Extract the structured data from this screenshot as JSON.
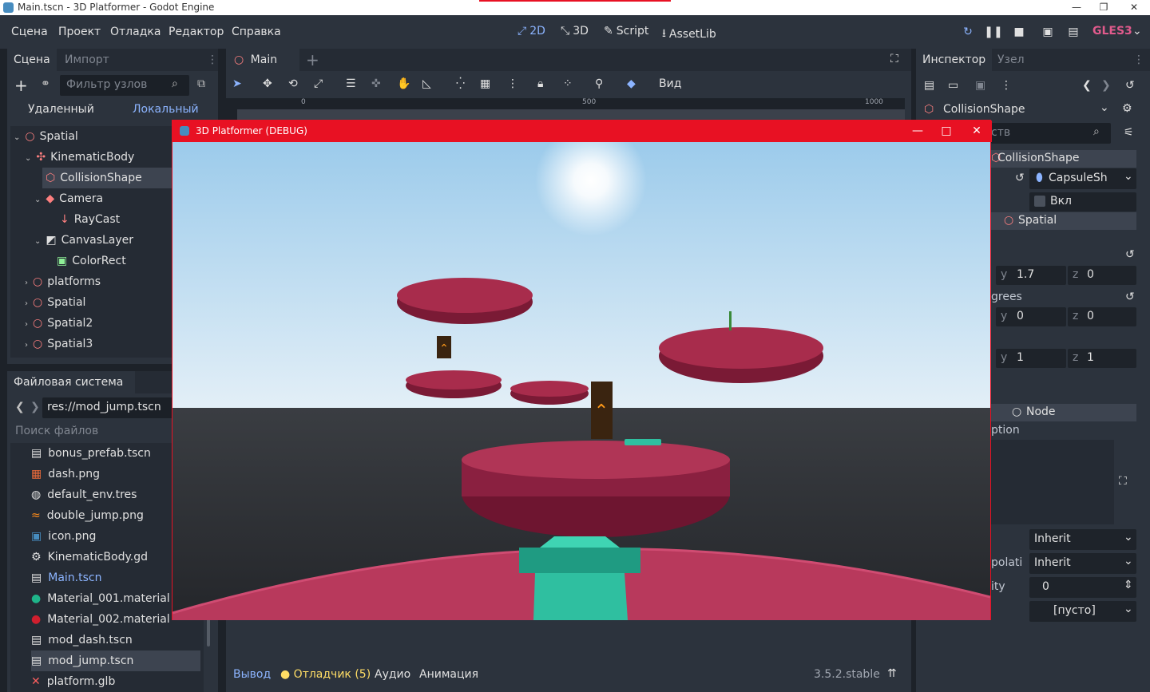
{
  "window": {
    "title": "Main.tscn - 3D Platformer - Godot Engine",
    "min": "—",
    "max": "❐",
    "close": "✕"
  },
  "menu": [
    "Сцена",
    "Проект",
    "Отладка",
    "Редактор",
    "Справка"
  ],
  "modes": {
    "m2d": "2D",
    "m3d": "3D",
    "script": "Script",
    "assetlib": "AssetLib"
  },
  "renderer": "GLES3",
  "scene_dock": {
    "tabs": [
      "Сцена",
      "Импорт"
    ],
    "filter_placeholder": "Фильтр узлов",
    "remote": "Удаленный",
    "local": "Локальный",
    "nodes": [
      {
        "label": "Spatial"
      },
      {
        "label": "KinematicBody"
      },
      {
        "label": "CollisionShape"
      },
      {
        "label": "Camera"
      },
      {
        "label": "RayCast"
      },
      {
        "label": "CanvasLayer"
      },
      {
        "label": "ColorRect"
      },
      {
        "label": "platforms"
      },
      {
        "label": "Spatial"
      },
      {
        "label": "Spatial2"
      },
      {
        "label": "Spatial3"
      }
    ]
  },
  "fs_dock": {
    "title": "Файловая система",
    "path": "res://mod_jump.tscn",
    "search_placeholder": "Поиск файлов",
    "files": [
      {
        "label": "bonus_prefab.tscn"
      },
      {
        "label": "dash.png"
      },
      {
        "label": "default_env.tres"
      },
      {
        "label": "double_jump.png"
      },
      {
        "label": "icon.png"
      },
      {
        "label": "KinematicBody.gd"
      },
      {
        "label": "Main.tscn"
      },
      {
        "label": "Material_001.material"
      },
      {
        "label": "Material_002.material"
      },
      {
        "label": "mod_dash.tscn"
      },
      {
        "label": "mod_jump.tscn"
      },
      {
        "label": "platform.glb"
      }
    ]
  },
  "editor": {
    "tab": "Main",
    "view_menu": "Вид",
    "ruler": [
      "0",
      "500",
      "1000"
    ]
  },
  "bottom": {
    "output": "Вывод",
    "debugger": "Отладчик (5)",
    "audio": "Аудио",
    "animation": "Анимация",
    "version": "3.5.2.stable"
  },
  "inspector": {
    "tabs": [
      "Инспектор",
      "Узел"
    ],
    "object": "CollisionShape",
    "filter_text": "ств",
    "class_header": "CollisionShape",
    "shape_value": "CapsuleSh",
    "disabled_label": "Вкл",
    "spatial_header": "Spatial",
    "translation": {
      "y": "1.7",
      "z": "0"
    },
    "rot_label": "grees",
    "rotation": {
      "y": "0",
      "z": "0"
    },
    "scale": {
      "y": "1",
      "z": "1"
    },
    "node_header": "Node",
    "desc_label": "ption",
    "pause_mode": "Inherit",
    "phys_interp_label": "polati",
    "phys_interp": "Inherit",
    "priority_label": "ity",
    "priority": "0",
    "script": "[пусто]"
  },
  "game": {
    "title": "3D Platformer (DEBUG)"
  }
}
